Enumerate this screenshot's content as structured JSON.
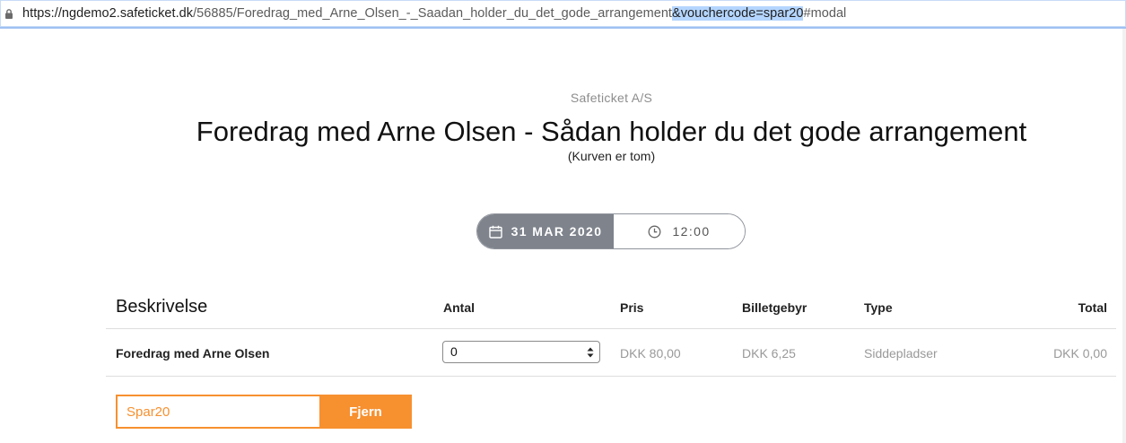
{
  "browser": {
    "url_host": "https://ngdemo2.safeticket.dk",
    "url_path": "/56885/Foredrag_med_Arne_Olsen_-_Saadan_holder_du_det_gode_arrangement",
    "url_selected": "&vouchercode=spar20",
    "url_tail": "#modal",
    "lock_icon": "lock-icon"
  },
  "event": {
    "organizer": "Safeticket A/S",
    "title": "Foredrag med Arne Olsen - Sådan holder du det gode arrangement",
    "cart_status": "(Kurven er tom)"
  },
  "datetime": {
    "date": "31 MAR 2020",
    "time": "12:00",
    "date_icon": "calendar-icon",
    "time_icon": "clock-icon"
  },
  "table": {
    "headers": {
      "description": "Beskrivelse",
      "quantity": "Antal",
      "price": "Pris",
      "fee": "Billetgebyr",
      "type": "Type",
      "total": "Total"
    },
    "rows": [
      {
        "description": "Foredrag med Arne Olsen",
        "quantity": "0",
        "price": "DKK 80,00",
        "fee": "DKK 6,25",
        "type": "Siddepladser",
        "total": "DKK 0,00"
      }
    ]
  },
  "voucher": {
    "code": "Spar20",
    "button_label": "Fjern"
  },
  "colors": {
    "accent": "#f7902f",
    "date_bg": "#7e838c",
    "url_selection": "#b4d5fe"
  }
}
